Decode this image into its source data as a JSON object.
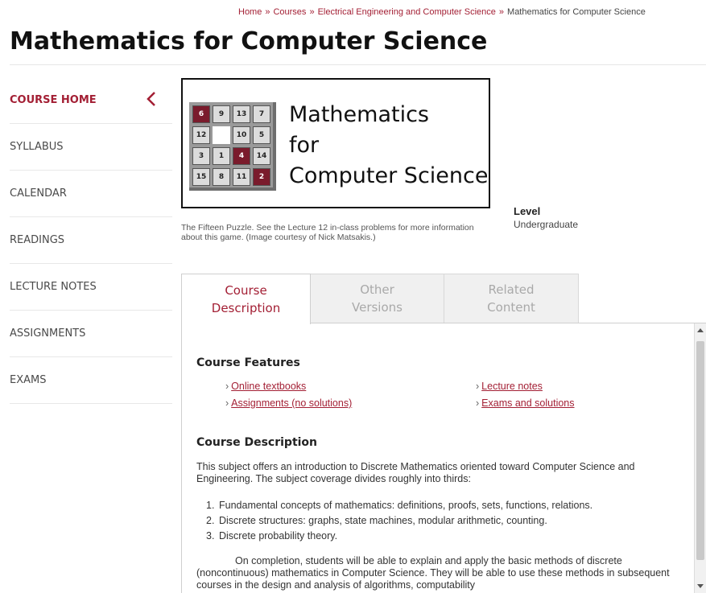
{
  "breadcrumb": {
    "items": [
      "Home",
      "Courses",
      "Electrical Engineering and Computer Science"
    ],
    "separator": "»",
    "current": "Mathematics for Computer Science"
  },
  "page": {
    "title": "Mathematics for Computer Science"
  },
  "sidebar": {
    "items": [
      {
        "label": "COURSE HOME",
        "active": true
      },
      {
        "label": "SYLLABUS"
      },
      {
        "label": "CALENDAR"
      },
      {
        "label": "READINGS"
      },
      {
        "label": "LECTURE NOTES"
      },
      {
        "label": "ASSIGNMENTS"
      },
      {
        "label": "EXAMS"
      }
    ],
    "collapse_icon": "chevron-left-icon"
  },
  "course_image": {
    "text_line1": "Mathematics",
    "text_line2": "for",
    "text_line3": "Computer Science",
    "puzzle_tiles": [
      [
        "6",
        "9",
        "13",
        "7"
      ],
      [
        "12",
        "",
        "10",
        "5"
      ],
      [
        "3",
        "1",
        "4",
        "14"
      ],
      [
        "15",
        "8",
        "11",
        "2"
      ]
    ],
    "caption": "The Fifteen Puzzle. See the Lecture 12 in-class problems for more information about this game. (Image courtesy of Nick Matsakis.)"
  },
  "level": {
    "label": "Level",
    "value": "Undergraduate"
  },
  "tabs": [
    {
      "line1": "Course",
      "line2": "Description",
      "active": true
    },
    {
      "line1": "Other",
      "line2": "Versions"
    },
    {
      "line1": "Related",
      "line2": "Content"
    }
  ],
  "course_features": {
    "heading": "Course Features",
    "left": [
      "Online textbooks",
      "Assignments (no solutions)"
    ],
    "right": [
      "Lecture notes",
      "Exams and solutions"
    ],
    "bullet": "›"
  },
  "course_description": {
    "heading": "Course Description",
    "intro": "This subject offers an introduction to Discrete Mathematics oriented toward Computer Science and Engineering. The subject coverage divides roughly into thirds:",
    "list": [
      "Fundamental concepts of mathematics: definitions, proofs, sets, functions, relations.",
      "Discrete structures: graphs, state machines, modular arithmetic, counting.",
      "Discrete probability theory."
    ],
    "outro": "On completion, students will be able to explain and apply the basic methods of discrete (noncontinuous) mathematics in Computer Science. They will be able to use these methods in subsequent courses in the design and analysis of algorithms, computability"
  },
  "colors": {
    "accent": "#a31f34",
    "tile_dark": "#7a1b2c",
    "tab_inactive_bg": "#f0f0f0",
    "tab_inactive_text": "#a9a9a9"
  }
}
